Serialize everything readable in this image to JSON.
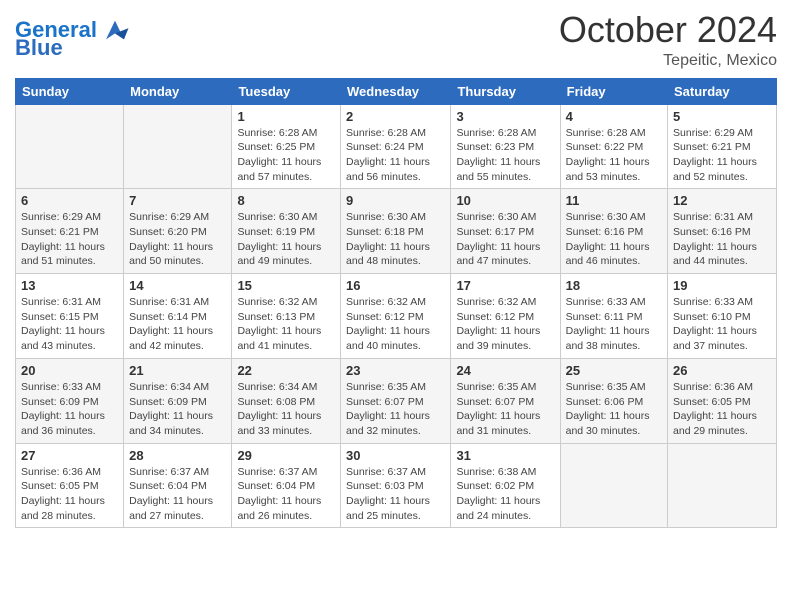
{
  "header": {
    "logo_general": "General",
    "logo_blue": "Blue",
    "month": "October 2024",
    "location": "Tepeitic, Mexico"
  },
  "days_of_week": [
    "Sunday",
    "Monday",
    "Tuesday",
    "Wednesday",
    "Thursday",
    "Friday",
    "Saturday"
  ],
  "weeks": [
    [
      {
        "day": "",
        "info": ""
      },
      {
        "day": "",
        "info": ""
      },
      {
        "day": "1",
        "info": "Sunrise: 6:28 AM\nSunset: 6:25 PM\nDaylight: 11 hours and 57 minutes."
      },
      {
        "day": "2",
        "info": "Sunrise: 6:28 AM\nSunset: 6:24 PM\nDaylight: 11 hours and 56 minutes."
      },
      {
        "day": "3",
        "info": "Sunrise: 6:28 AM\nSunset: 6:23 PM\nDaylight: 11 hours and 55 minutes."
      },
      {
        "day": "4",
        "info": "Sunrise: 6:28 AM\nSunset: 6:22 PM\nDaylight: 11 hours and 53 minutes."
      },
      {
        "day": "5",
        "info": "Sunrise: 6:29 AM\nSunset: 6:21 PM\nDaylight: 11 hours and 52 minutes."
      }
    ],
    [
      {
        "day": "6",
        "info": "Sunrise: 6:29 AM\nSunset: 6:21 PM\nDaylight: 11 hours and 51 minutes."
      },
      {
        "day": "7",
        "info": "Sunrise: 6:29 AM\nSunset: 6:20 PM\nDaylight: 11 hours and 50 minutes."
      },
      {
        "day": "8",
        "info": "Sunrise: 6:30 AM\nSunset: 6:19 PM\nDaylight: 11 hours and 49 minutes."
      },
      {
        "day": "9",
        "info": "Sunrise: 6:30 AM\nSunset: 6:18 PM\nDaylight: 11 hours and 48 minutes."
      },
      {
        "day": "10",
        "info": "Sunrise: 6:30 AM\nSunset: 6:17 PM\nDaylight: 11 hours and 47 minutes."
      },
      {
        "day": "11",
        "info": "Sunrise: 6:30 AM\nSunset: 6:16 PM\nDaylight: 11 hours and 46 minutes."
      },
      {
        "day": "12",
        "info": "Sunrise: 6:31 AM\nSunset: 6:16 PM\nDaylight: 11 hours and 44 minutes."
      }
    ],
    [
      {
        "day": "13",
        "info": "Sunrise: 6:31 AM\nSunset: 6:15 PM\nDaylight: 11 hours and 43 minutes."
      },
      {
        "day": "14",
        "info": "Sunrise: 6:31 AM\nSunset: 6:14 PM\nDaylight: 11 hours and 42 minutes."
      },
      {
        "day": "15",
        "info": "Sunrise: 6:32 AM\nSunset: 6:13 PM\nDaylight: 11 hours and 41 minutes."
      },
      {
        "day": "16",
        "info": "Sunrise: 6:32 AM\nSunset: 6:12 PM\nDaylight: 11 hours and 40 minutes."
      },
      {
        "day": "17",
        "info": "Sunrise: 6:32 AM\nSunset: 6:12 PM\nDaylight: 11 hours and 39 minutes."
      },
      {
        "day": "18",
        "info": "Sunrise: 6:33 AM\nSunset: 6:11 PM\nDaylight: 11 hours and 38 minutes."
      },
      {
        "day": "19",
        "info": "Sunrise: 6:33 AM\nSunset: 6:10 PM\nDaylight: 11 hours and 37 minutes."
      }
    ],
    [
      {
        "day": "20",
        "info": "Sunrise: 6:33 AM\nSunset: 6:09 PM\nDaylight: 11 hours and 36 minutes."
      },
      {
        "day": "21",
        "info": "Sunrise: 6:34 AM\nSunset: 6:09 PM\nDaylight: 11 hours and 34 minutes."
      },
      {
        "day": "22",
        "info": "Sunrise: 6:34 AM\nSunset: 6:08 PM\nDaylight: 11 hours and 33 minutes."
      },
      {
        "day": "23",
        "info": "Sunrise: 6:35 AM\nSunset: 6:07 PM\nDaylight: 11 hours and 32 minutes."
      },
      {
        "day": "24",
        "info": "Sunrise: 6:35 AM\nSunset: 6:07 PM\nDaylight: 11 hours and 31 minutes."
      },
      {
        "day": "25",
        "info": "Sunrise: 6:35 AM\nSunset: 6:06 PM\nDaylight: 11 hours and 30 minutes."
      },
      {
        "day": "26",
        "info": "Sunrise: 6:36 AM\nSunset: 6:05 PM\nDaylight: 11 hours and 29 minutes."
      }
    ],
    [
      {
        "day": "27",
        "info": "Sunrise: 6:36 AM\nSunset: 6:05 PM\nDaylight: 11 hours and 28 minutes."
      },
      {
        "day": "28",
        "info": "Sunrise: 6:37 AM\nSunset: 6:04 PM\nDaylight: 11 hours and 27 minutes."
      },
      {
        "day": "29",
        "info": "Sunrise: 6:37 AM\nSunset: 6:04 PM\nDaylight: 11 hours and 26 minutes."
      },
      {
        "day": "30",
        "info": "Sunrise: 6:37 AM\nSunset: 6:03 PM\nDaylight: 11 hours and 25 minutes."
      },
      {
        "day": "31",
        "info": "Sunrise: 6:38 AM\nSunset: 6:02 PM\nDaylight: 11 hours and 24 minutes."
      },
      {
        "day": "",
        "info": ""
      },
      {
        "day": "",
        "info": ""
      }
    ]
  ]
}
